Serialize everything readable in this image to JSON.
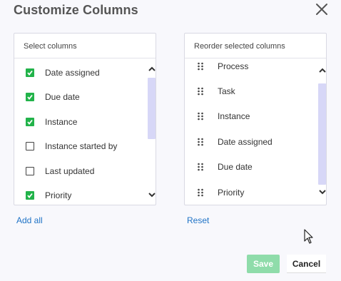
{
  "dialog": {
    "title": "Customize Columns",
    "close_icon": "close-icon"
  },
  "select_panel": {
    "header": "Select columns",
    "items": [
      {
        "label": "Date assigned",
        "checked": true
      },
      {
        "label": "Due date",
        "checked": true
      },
      {
        "label": "Instance",
        "checked": true
      },
      {
        "label": "Instance started by",
        "checked": false
      },
      {
        "label": "Last updated",
        "checked": false
      },
      {
        "label": "Priority",
        "checked": true
      }
    ],
    "scroll_up_icon": "chevron-up-icon",
    "scroll_down_icon": "chevron-down-icon"
  },
  "reorder_panel": {
    "header": "Reorder selected columns",
    "items": [
      {
        "label": "Process"
      },
      {
        "label": "Task"
      },
      {
        "label": "Instance"
      },
      {
        "label": "Date assigned"
      },
      {
        "label": "Due date"
      },
      {
        "label": "Priority"
      }
    ],
    "drag_icon": "drag-handle-icon"
  },
  "links": {
    "add_all": "Add all",
    "reset": "Reset"
  },
  "footer": {
    "save_label": "Save",
    "cancel_label": "Cancel"
  },
  "colors": {
    "accent_green": "#22b34a",
    "save_disabled": "#8fdcaa",
    "link_blue": "#1f73c6",
    "scroll_thumb": "#d7d7f7"
  }
}
